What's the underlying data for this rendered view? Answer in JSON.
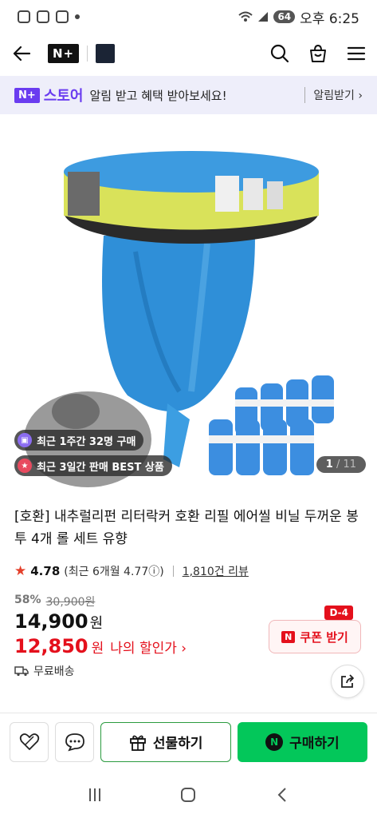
{
  "status_bar": {
    "battery": "64",
    "time": "오후 6:25"
  },
  "header": {
    "brand": "N+",
    "icons": [
      "back-icon",
      "search-icon",
      "bag-icon",
      "menu-icon"
    ]
  },
  "promo": {
    "badge": "N+",
    "store": "스토어",
    "message": "알림 받고 혜택 받아보세요!",
    "cta": "알림받기 ›"
  },
  "gallery": {
    "chip_weekly": "최근 1주간 32명 구매",
    "chip_best": "최근 3일간 판매 BEST 상품",
    "current": "1",
    "total": "/ 11"
  },
  "product": {
    "title": "[호환] 내추럴리펀 리터락커 호환 리필 에어씰 비닐 두꺼운 봉투 4개 롤 세트 유향",
    "rating": "4.78",
    "rating_recent": "(최근 6개월 4.77ⓘ)",
    "reviews": "1,810건 리뷰",
    "discount_pct": "58%",
    "original_price": "30,900원",
    "price": "14,900",
    "price_unit": "원",
    "my_price": "12,850",
    "my_price_unit": "원",
    "my_price_label": "나의 할인가 ›",
    "coupon_label": "쿠폰 받기",
    "coupon_dday": "D-4",
    "shipping": "무료배송"
  },
  "actions": {
    "gift": "선물하기",
    "buy": "구매하기"
  },
  "colors": {
    "accent_green": "#03c75a",
    "discount_red": "#e4101c",
    "store_purple": "#6a3cf0"
  }
}
